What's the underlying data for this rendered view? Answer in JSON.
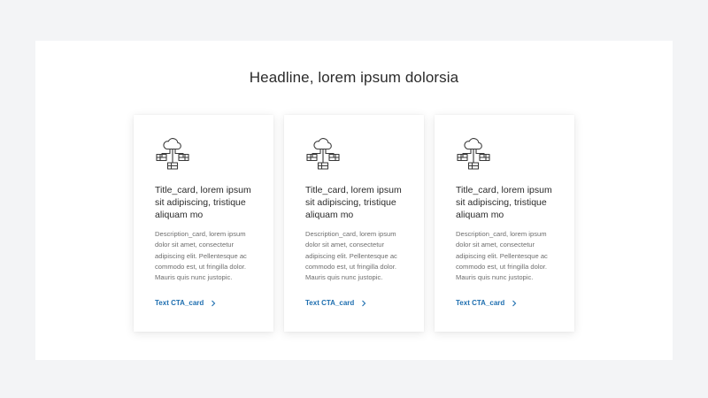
{
  "section": {
    "headline": "Headline, lorem ipsum dolorsia"
  },
  "colors": {
    "background": "#f3f4f6",
    "panel": "#ffffff",
    "text_primary": "#2b2b2b",
    "text_secondary": "#6e6e6e",
    "link": "#1f6fb0"
  },
  "cards": [
    {
      "icon": "cloud-network-icon",
      "title": "Title_card, lorem ipsum sit adipiscing, tristique aliquam mo",
      "description": "Description_card, lorem ipsum dolor sit amet, consectetur adipiscing elit. Pellentesque ac commodo est, ut fringilla dolor. Mauris quis nunc justopic.",
      "cta_label": "Text CTA_card"
    },
    {
      "icon": "cloud-network-icon",
      "title": "Title_card, lorem ipsum sit adipiscing, tristique aliquam mo",
      "description": "Description_card, lorem ipsum dolor sit amet, consectetur adipiscing elit. Pellentesque ac commodo est, ut fringilla dolor. Mauris quis nunc justopic.",
      "cta_label": "Text CTA_card"
    },
    {
      "icon": "cloud-network-icon",
      "title": "Title_card, lorem ipsum sit adipiscing, tristique aliquam mo",
      "description": "Description_card, lorem ipsum dolor sit amet, consectetur adipiscing elit. Pellentesque ac commodo est, ut fringilla dolor. Mauris quis nunc justopic.",
      "cta_label": "Text CTA_card"
    }
  ]
}
